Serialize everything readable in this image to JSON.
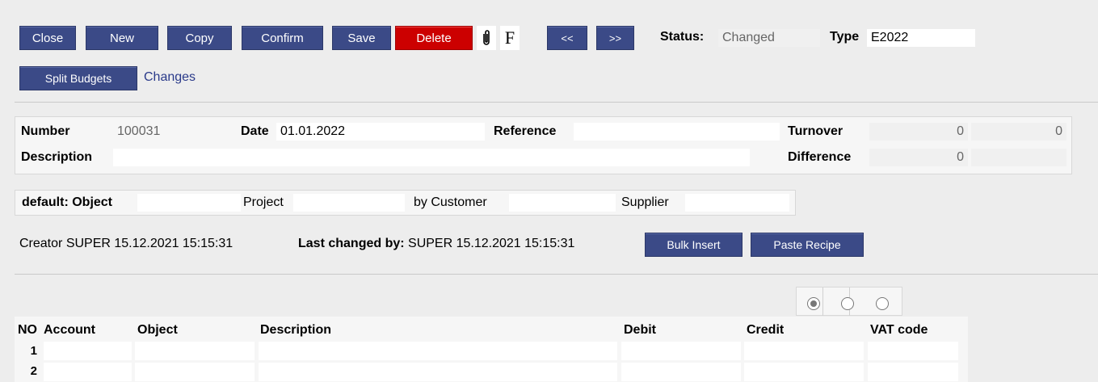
{
  "toolbar": {
    "close": "Close",
    "new": "New",
    "copy": "Copy",
    "confirm": "Confirm",
    "save": "Save",
    "delete": "Delete",
    "attach_icon": "paperclip-icon",
    "f_label": "F",
    "prev": "<<",
    "next": ">>",
    "status_label": "Status:",
    "status_value": "Changed",
    "type_label": "Type",
    "type_value": "E2022",
    "split_budgets": "Split Budgets",
    "changes_link": "Changes"
  },
  "header": {
    "number_label": "Number",
    "number_value": "100031",
    "date_label": "Date",
    "date_value": "01.01.2022",
    "reference_label": "Reference",
    "reference_value": "",
    "turnover_label": "Turnover",
    "turnover_debit": "0",
    "turnover_credit": "0",
    "description_label": "Description",
    "description_value": "",
    "difference_label": "Difference",
    "difference_value": "0",
    "difference_extra": ""
  },
  "defaults": {
    "object_label": "default: Object",
    "object_value": "",
    "project_label": "Project",
    "project_value": "",
    "customer_label": "by Customer",
    "customer_value": "",
    "supplier_label": "Supplier",
    "supplier_value": ""
  },
  "info": {
    "creator_label": "Creator",
    "creator_text": "SUPER 15.12.2021 15:15:31",
    "changed_label": "Last changed by:",
    "changed_text": "SUPER 15.12.2021 15:15:31",
    "bulk_insert": "Bulk Insert",
    "paste_recipe": "Paste Recipe"
  },
  "grid": {
    "columns": [
      "NO",
      "Account",
      "Object",
      "Description",
      "Debit",
      "Credit",
      "VAT code"
    ],
    "rows": [
      {
        "no": "1",
        "account": "",
        "object": "",
        "description": "",
        "debit": "",
        "credit": "",
        "vat": ""
      },
      {
        "no": "2",
        "account": "",
        "object": "",
        "description": "",
        "debit": "",
        "credit": "",
        "vat": ""
      }
    ],
    "view_selected": 1
  },
  "colors": {
    "button": "#3b4a87",
    "delete": "#cc0000",
    "link": "#2a3a8a",
    "background": "#ededed"
  }
}
